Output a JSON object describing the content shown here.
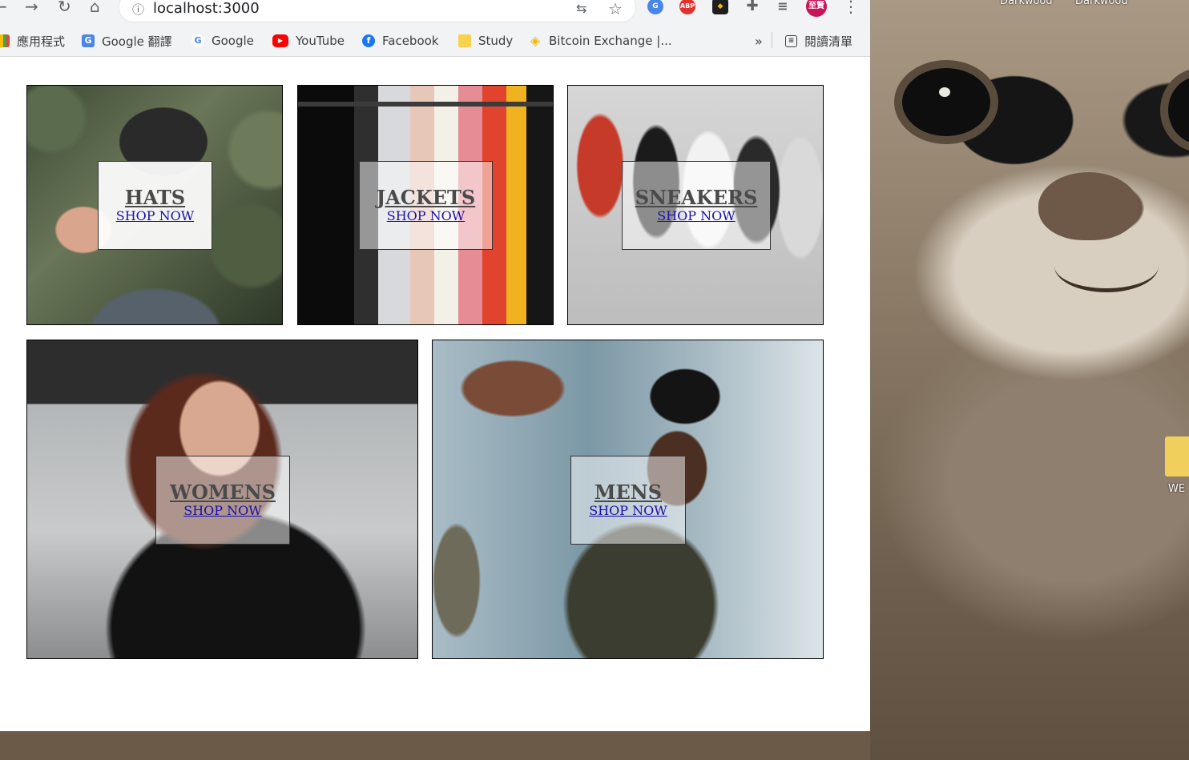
{
  "browser": {
    "url": "localhost:3000",
    "bookmarks": [
      {
        "label": "應用程式",
        "icon": "apps-grid-icon"
      },
      {
        "label": "Google 翻譯",
        "icon": "google-translate-icon"
      },
      {
        "label": "Google",
        "icon": "google-g-icon"
      },
      {
        "label": "YouTube",
        "icon": "youtube-icon"
      },
      {
        "label": "Facebook",
        "icon": "facebook-icon"
      },
      {
        "label": "Study",
        "icon": "folder-icon"
      },
      {
        "label": "Bitcoin Exchange |...",
        "icon": "binance-icon"
      }
    ],
    "more_bookmarks": "»",
    "reading_list": "閱讀清單",
    "profile_initials": "至賢",
    "extensions": [
      "translate-extension-icon",
      "adblock-plus-icon",
      "binance-extension-icon",
      "puzzle-icon",
      "media-icon"
    ]
  },
  "desktop": {
    "top_labels": [
      "Darkwood",
      "Darkwood"
    ],
    "folder_label": "WE"
  },
  "directory": {
    "sections": [
      {
        "title": "HATS",
        "subtitle": "SHOP NOW"
      },
      {
        "title": "JACKETS",
        "subtitle": "SHOP NOW"
      },
      {
        "title": "SNEAKERS",
        "subtitle": "SHOP NOW"
      },
      {
        "title": "WOMENS",
        "subtitle": "SHOP NOW"
      },
      {
        "title": "MENS",
        "subtitle": "SHOP NOW"
      }
    ]
  }
}
